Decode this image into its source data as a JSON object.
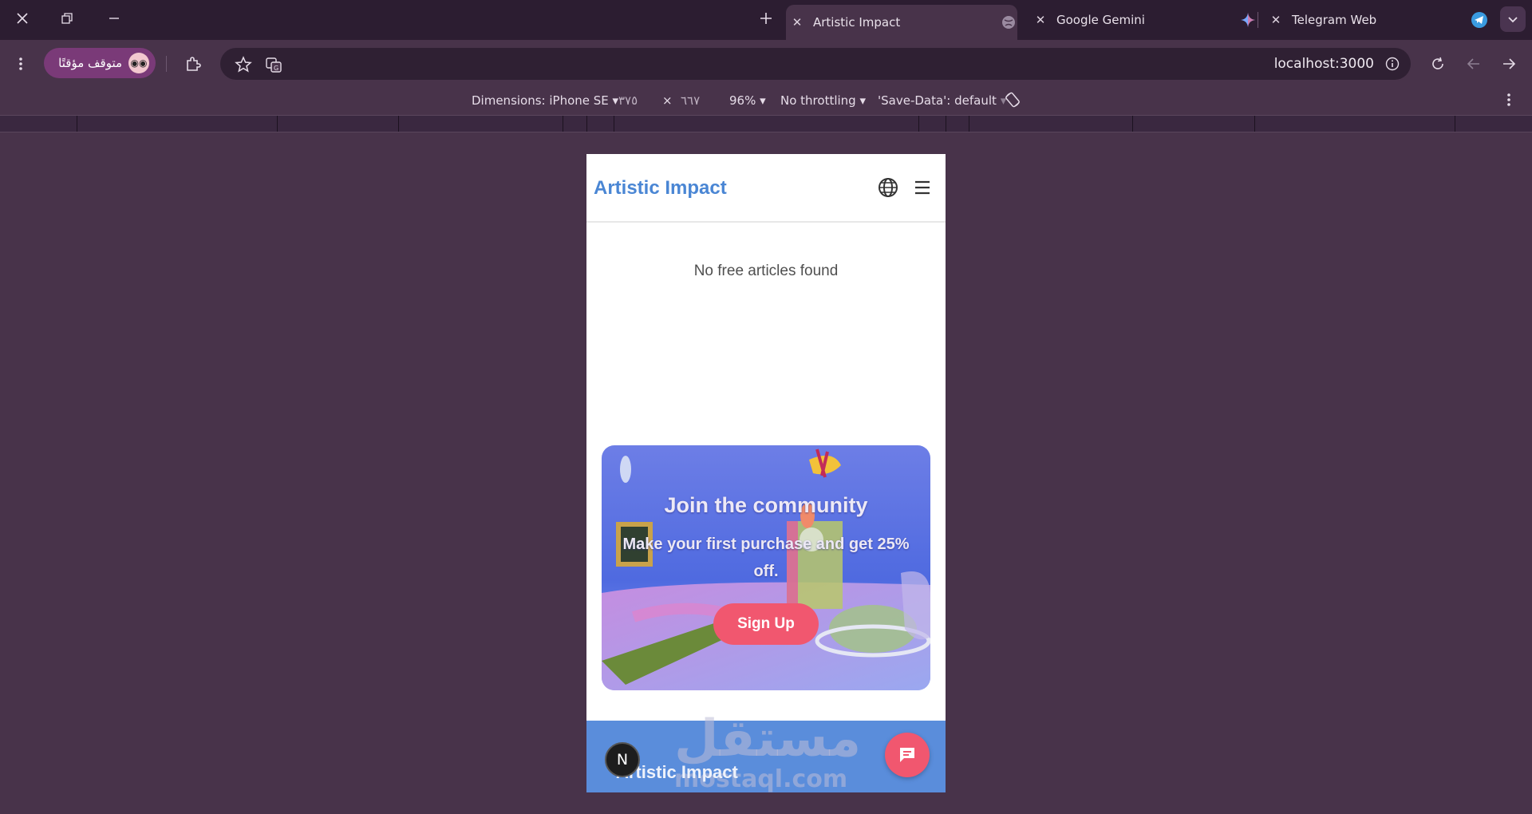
{
  "browser": {
    "tabs": [
      {
        "title": "Artistic Impact",
        "active": true
      },
      {
        "title": "Google Gemini",
        "active": false
      },
      {
        "title": "Telegram Web",
        "active": false
      }
    ],
    "profile_label": "متوقف مؤقتًا",
    "url": "localhost:3000",
    "icons": [
      "close-icon",
      "restore-icon",
      "minimize-icon",
      "new-tab-icon",
      "kebab-menu-icon",
      "extensions-icon",
      "star-icon",
      "translate-icon",
      "site-info-icon",
      "reload-icon",
      "back-icon",
      "forward-icon",
      "tab-search-chevron-icon",
      "gemini-icon",
      "telegram-icon",
      "globe-icon"
    ]
  },
  "devtools": {
    "dimensions": "Dimensions: iPhone SE",
    "width": "٣٧٥",
    "times": "×",
    "height": "٦٦٧",
    "zoom": "96%",
    "throttling": "No throttling",
    "save_data": "'Save-Data': default"
  },
  "site": {
    "brand": "Artistic Impact",
    "empty_message": "No free articles found",
    "promo": {
      "title": "Join the community",
      "text": "Make your first purchase and get 25% off.",
      "button": "Sign Up"
    },
    "footer_brand": "Artistic Impact",
    "watermark": "مستقل",
    "watermark_sub": "mostaql.com",
    "next_badge": "N"
  },
  "colors": {
    "browser_bg": "#48334a",
    "tabstrip_bg": "#2c1d31",
    "brand_blue": "#4a86d4",
    "footer_blue": "#5a8ddb",
    "cta_pink": "#f1576f"
  }
}
